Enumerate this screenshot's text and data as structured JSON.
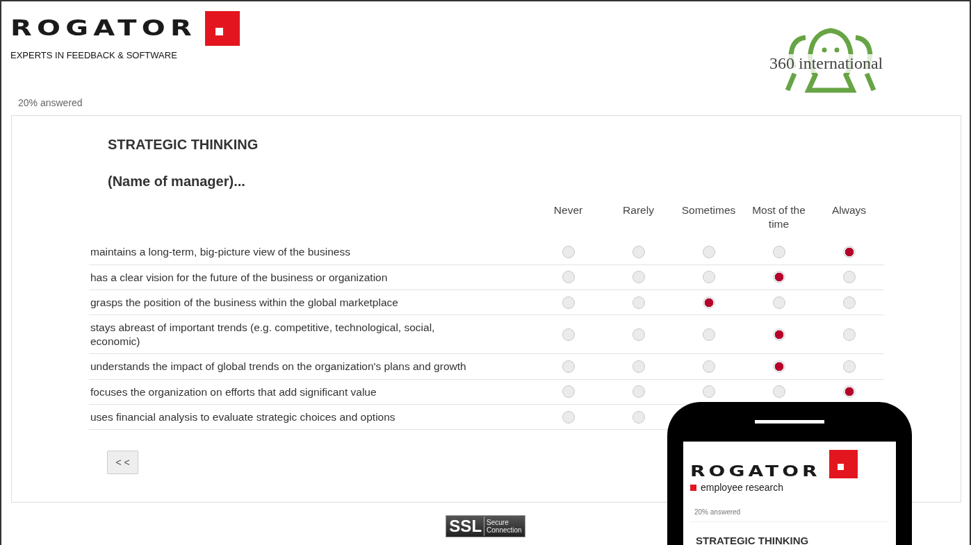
{
  "header": {
    "logo": {
      "wordmark": "ROGATOR",
      "tagline": "EXPERTS IN FEEDBACK & SOFTWARE"
    },
    "partner_logo": "360 international"
  },
  "progress": "20% answered",
  "survey": {
    "title": "STRATEGIC THINKING",
    "subtitle": "(Name of manager)...",
    "columns": [
      "Never",
      "Rarely",
      "Sometimes",
      "Most of the time",
      "Always"
    ],
    "rows": [
      {
        "statement": "maintains a long-term, big-picture view of the business",
        "options": [
          {
            "selected": false
          },
          {
            "selected": false
          },
          {
            "selected": false
          },
          {
            "selected": false
          },
          {
            "selected": true
          }
        ]
      },
      {
        "statement": "has a clear vision for the future of the business or organization",
        "options": [
          {
            "selected": false
          },
          {
            "selected": false
          },
          {
            "selected": false
          },
          {
            "selected": true
          },
          {
            "selected": false
          }
        ]
      },
      {
        "statement": "grasps the position of the business within the global marketplace",
        "options": [
          {
            "selected": false
          },
          {
            "selected": false
          },
          {
            "selected": true
          },
          {
            "selected": false
          },
          {
            "selected": false
          }
        ]
      },
      {
        "statement": "stays abreast of important trends (e.g. competitive, technological, social, economic)",
        "options": [
          {
            "selected": false
          },
          {
            "selected": false
          },
          {
            "selected": false
          },
          {
            "selected": true
          },
          {
            "selected": false
          }
        ]
      },
      {
        "statement": "understands the impact of global trends on the organization's plans and growth",
        "options": [
          {
            "selected": false
          },
          {
            "selected": false
          },
          {
            "selected": false
          },
          {
            "selected": true
          },
          {
            "selected": false
          }
        ]
      },
      {
        "statement": "focuses the organization on efforts that add significant value",
        "options": [
          {
            "selected": false
          },
          {
            "selected": false
          },
          {
            "selected": false
          },
          {
            "selected": false
          },
          {
            "selected": true
          }
        ]
      },
      {
        "statement": "uses financial analysis to evaluate strategic choices and options",
        "options": [
          {
            "selected": false
          },
          {
            "selected": false
          }
        ]
      }
    ],
    "back_button": "< <"
  },
  "ssl_badge": {
    "main": "SSL",
    "sub_1": "Secure",
    "sub_2": "Connection"
  },
  "phone": {
    "wordmark": "ROGATOR",
    "tagline": "employee research",
    "progress": "20% answered",
    "title": "STRATEGIC THINKING"
  }
}
